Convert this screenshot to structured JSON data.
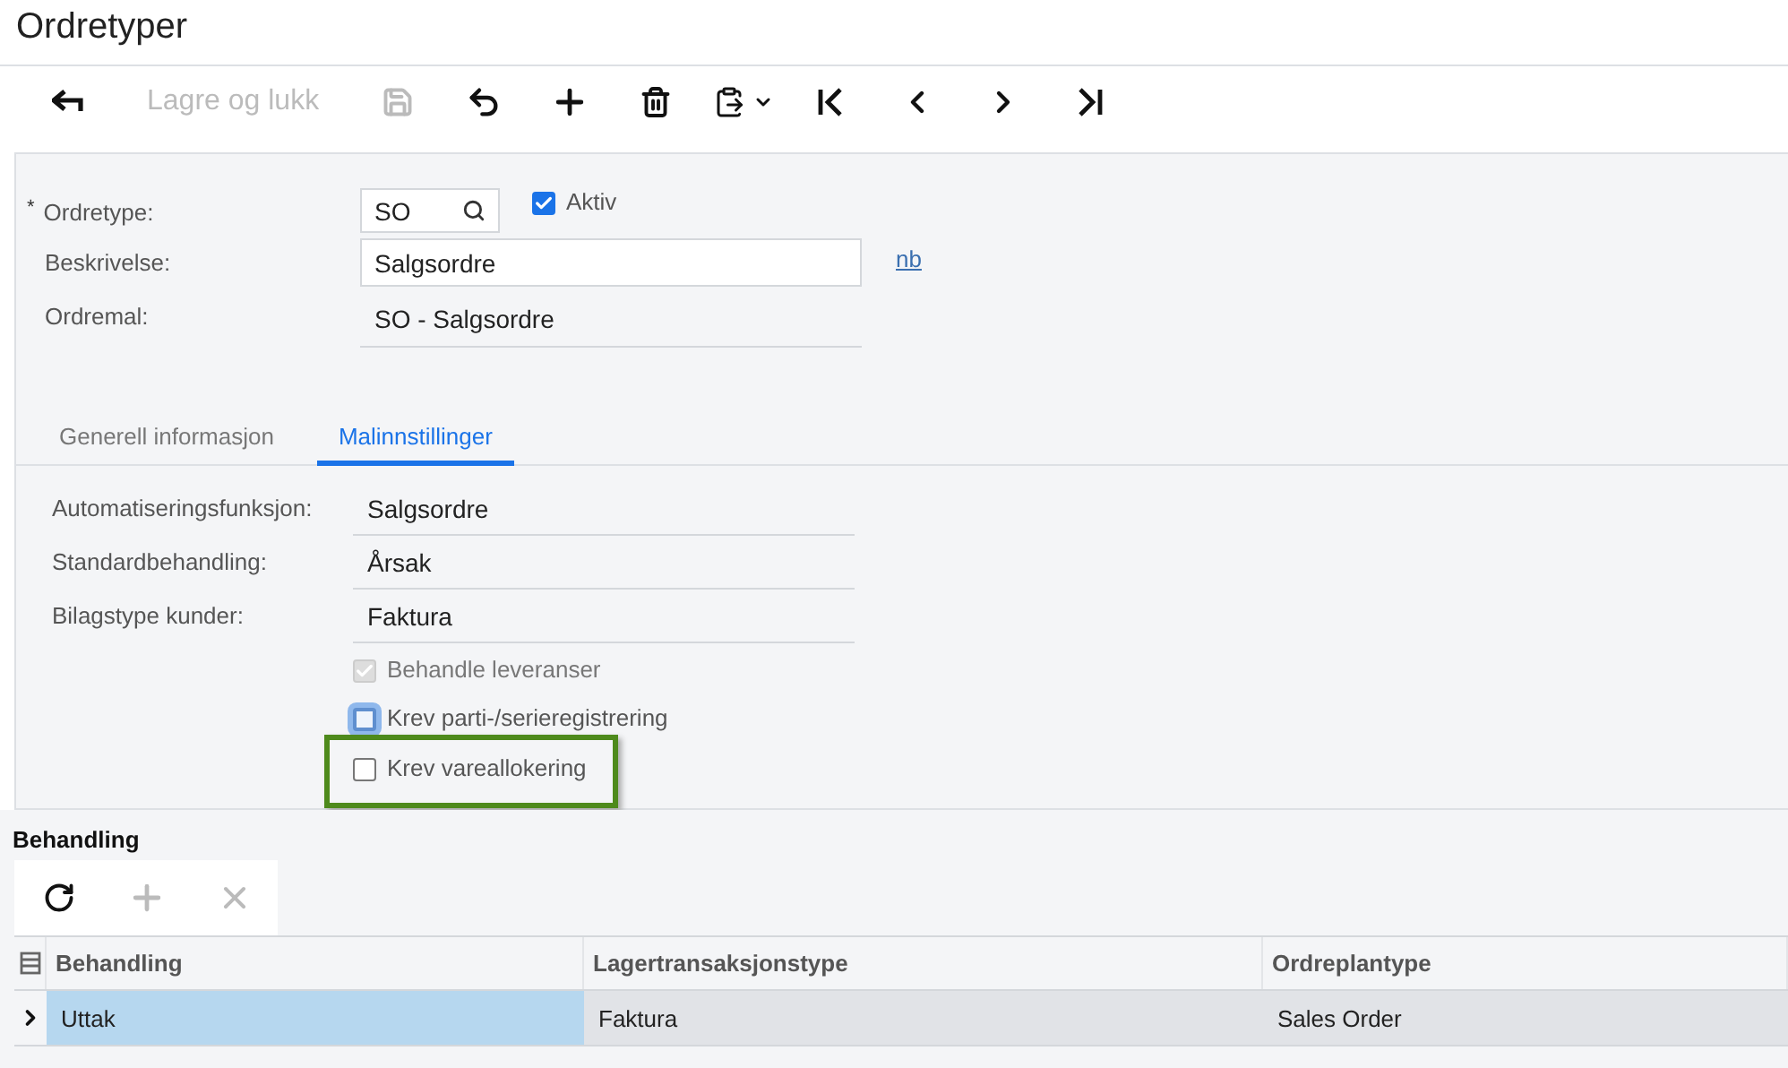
{
  "window": {
    "title": "Ordretyper"
  },
  "toolbar": [
    {
      "kind": "back",
      "disabled": false
    },
    {
      "kind": "text",
      "label": "Lagre og lukk",
      "disabled": true
    },
    {
      "kind": "save",
      "disabled": true
    },
    {
      "kind": "undo",
      "disabled": false
    },
    {
      "kind": "add",
      "disabled": false
    },
    {
      "kind": "delete",
      "disabled": false
    },
    {
      "kind": "clipboard",
      "disabled": false
    },
    {
      "kind": "first",
      "disabled": false
    },
    {
      "kind": "prev",
      "disabled": false
    },
    {
      "kind": "next",
      "disabled": false
    },
    {
      "kind": "last",
      "disabled": false
    }
  ],
  "header": {
    "order_type": {
      "label": "Ordretype:",
      "required_mark": "*",
      "value": "SO"
    },
    "active": {
      "label": "Aktiv",
      "checked": true
    },
    "description": {
      "label": "Beskrivelse:",
      "value": "Salgsordre",
      "link": "nb"
    },
    "template": {
      "label": "Ordremal:",
      "value": "SO - Salgsordre"
    }
  },
  "tabs": [
    {
      "label": "Generell informasjon",
      "selected": false
    },
    {
      "label": "Malinnstillinger",
      "selected": true
    }
  ],
  "settings": [
    {
      "label": "Automatiseringsfunksjon:",
      "value": "Salgsordre"
    },
    {
      "label": "Standardbehandling:",
      "value": "Årsak"
    },
    {
      "label": "Bilagstype kunder:",
      "value": "Faktura"
    }
  ],
  "options": [
    {
      "label": "Behandle leveranser",
      "checked": true,
      "disabled": true,
      "focused": false,
      "highlighted": false
    },
    {
      "label": "Krev parti-/serieregistrering",
      "checked": false,
      "disabled": false,
      "focused": true,
      "highlighted": false
    },
    {
      "label": "Krev vareallokering",
      "checked": false,
      "disabled": false,
      "focused": false,
      "highlighted": true
    }
  ],
  "grid": {
    "title": "Behandling",
    "toolbar": [
      {
        "kind": "refresh",
        "disabled": false
      },
      {
        "kind": "add",
        "disabled": true
      },
      {
        "kind": "delete",
        "disabled": true
      }
    ],
    "columns": [
      "Behandling",
      "Lagertransaksjonstype",
      "Ordreplantype"
    ],
    "rows": [
      {
        "cells": [
          "Uttak",
          "Faktura",
          "Sales Order"
        ],
        "selected": true
      }
    ]
  }
}
